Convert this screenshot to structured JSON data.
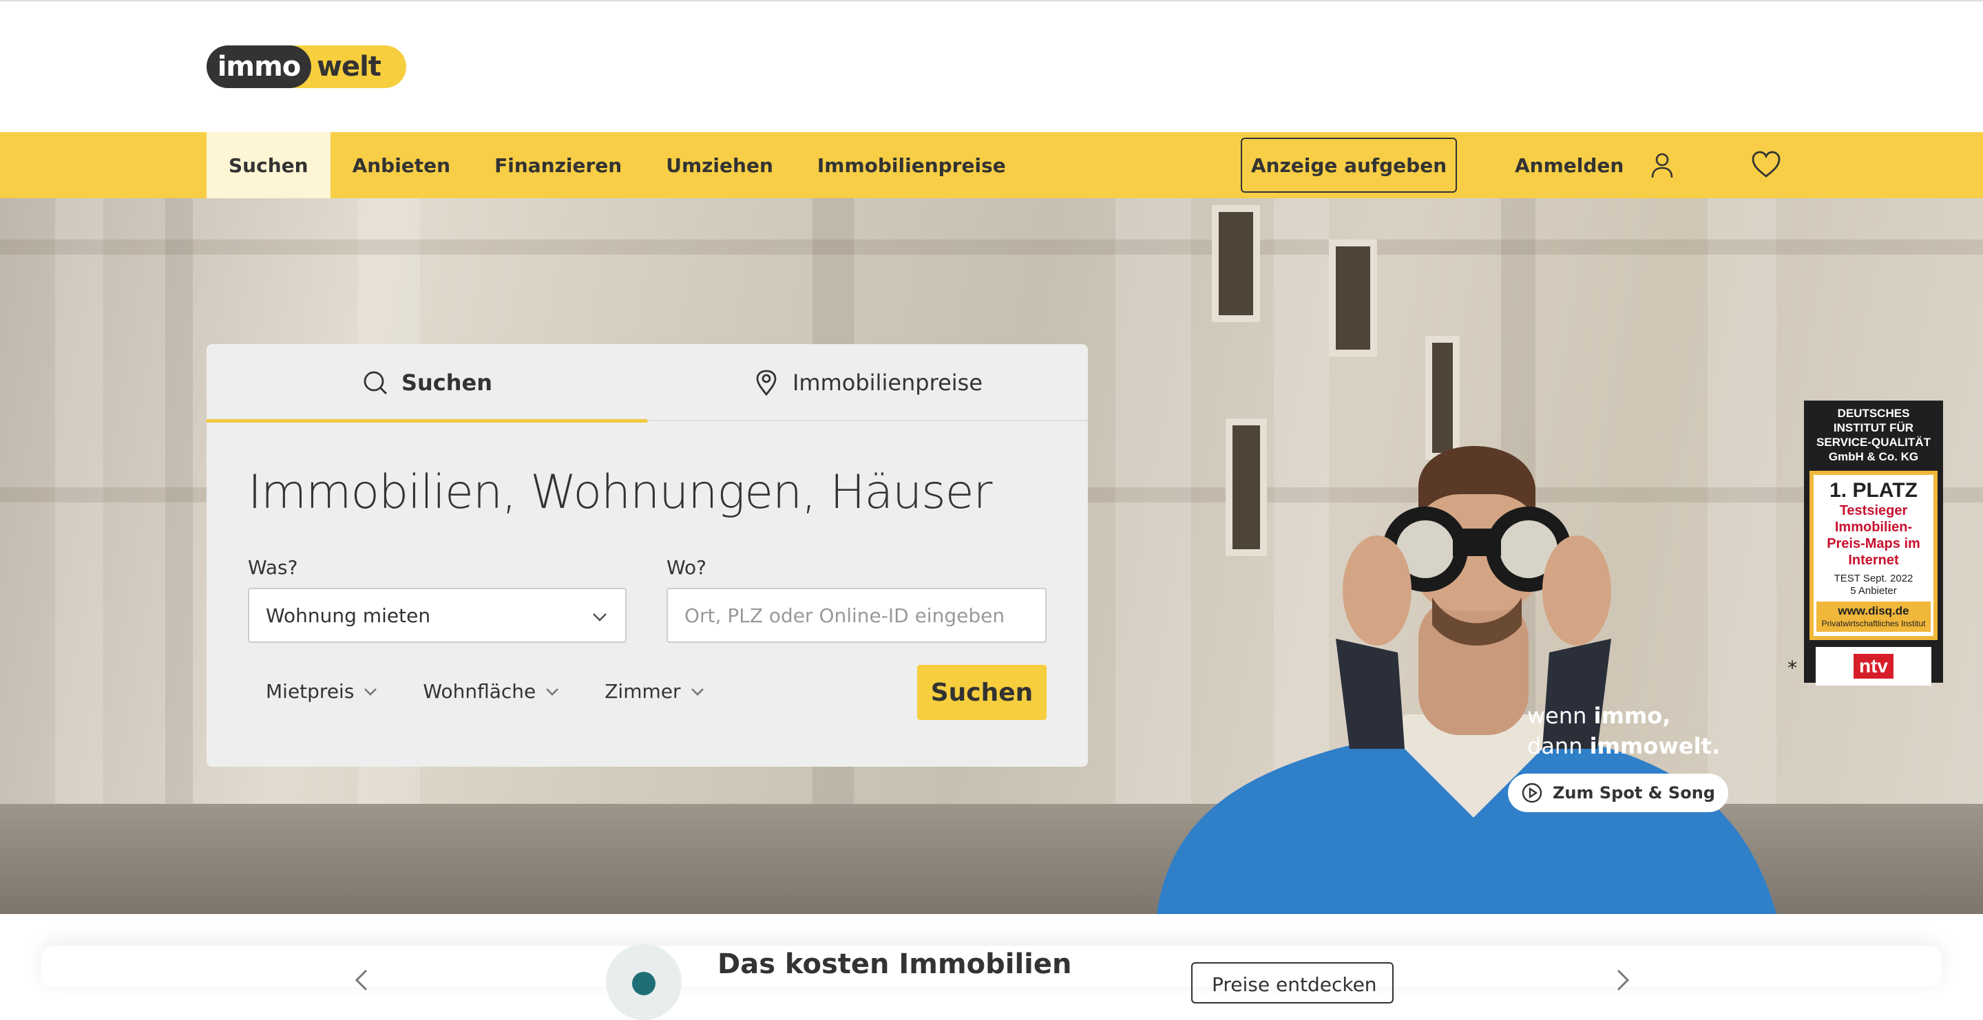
{
  "logo": {
    "part1": "immo",
    "part2": "welt"
  },
  "nav": {
    "items": [
      {
        "label": "Suchen",
        "active": true
      },
      {
        "label": "Anbieten",
        "active": false
      },
      {
        "label": "Finanzieren",
        "active": false
      },
      {
        "label": "Umziehen",
        "active": false
      },
      {
        "label": "Immobilienpreise",
        "active": false
      }
    ],
    "cta_label": "Anzeige aufgeben",
    "login_label": "Anmelden",
    "icons": {
      "user": "user-icon",
      "favorites": "heart-icon"
    }
  },
  "search_card": {
    "tabs": [
      {
        "label": "Suchen",
        "icon": "search-icon",
        "active": true
      },
      {
        "label": "Immobilienpreise",
        "icon": "location-pin-icon",
        "active": false
      }
    ],
    "title": "Immobilien, Wohnungen, Häuser",
    "what_label": "Was?",
    "what_value": "Wohnung mieten",
    "where_label": "Wo?",
    "where_placeholder": "Ort, PLZ oder Online-ID eingeben",
    "filters": [
      "Mietpreis",
      "Wohnfläche",
      "Zimmer"
    ],
    "search_button": "Suchen"
  },
  "hero": {
    "slogan_line1_pre": "wenn ",
    "slogan_line1_bold": "immo,",
    "slogan_line2_pre": "dann ",
    "slogan_line2_bold": "immowelt.",
    "spot_button": "Zum Spot & Song"
  },
  "badge": {
    "header": "DEUTSCHES INSTITUT FÜR SERVICE-QUALITÄT GmbH & Co. KG",
    "rank": "1. PLATZ",
    "award": "Testsieger Immobilien-Preis-Maps im Internet",
    "test_date": "TEST Sept. 2022",
    "providers": "5 Anbieter",
    "url": "www.disq.de",
    "institute": "Privatwirtschaftliches Institut",
    "partner": "ntv",
    "footnote": "*"
  },
  "bottom": {
    "title": "Das kosten Immobilien",
    "button": "Preise entdecken"
  },
  "colors": {
    "brand_yellow": "#f7ce45",
    "dark": "#333333",
    "card_bg": "#eeeeee",
    "badge_red": "#c8102e"
  }
}
